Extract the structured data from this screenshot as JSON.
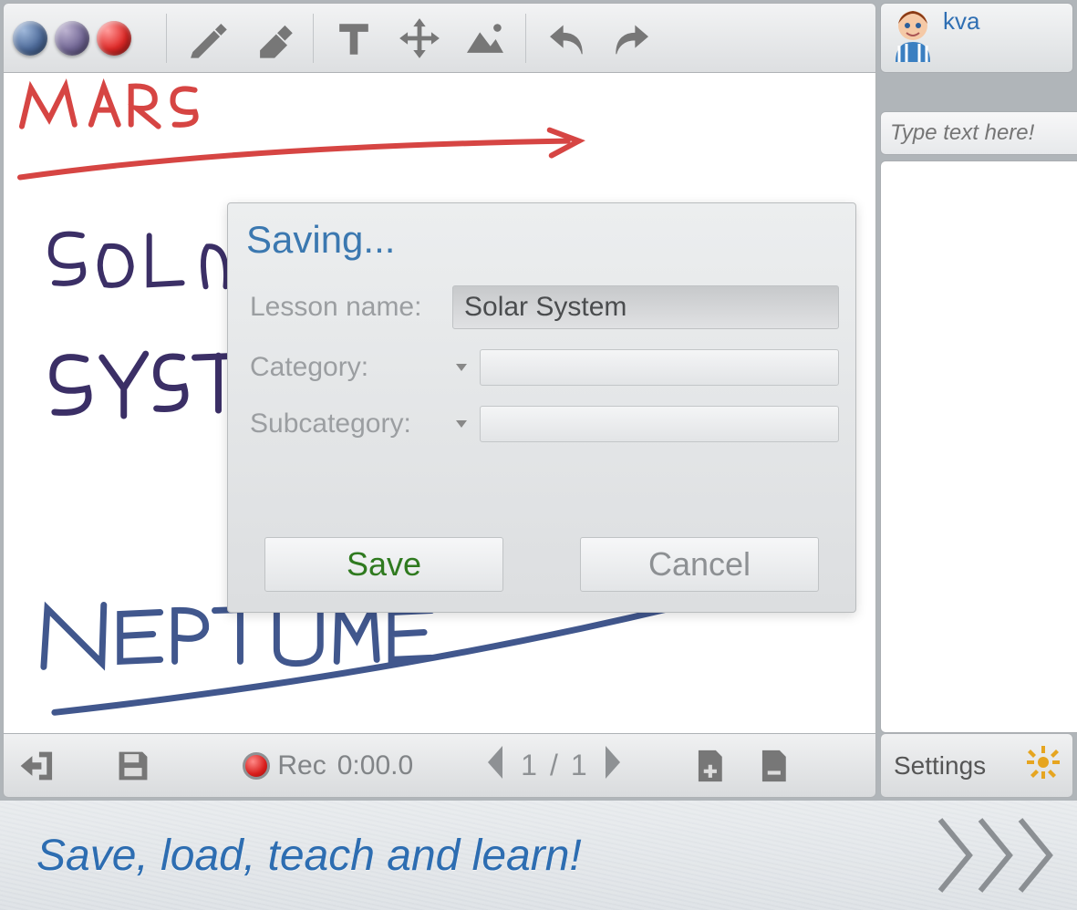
{
  "user": {
    "name": "kva"
  },
  "chat": {
    "placeholder": "Type text here!"
  },
  "toolbar": {
    "colors": [
      "blue",
      "purple",
      "red"
    ]
  },
  "canvas": {
    "words": [
      "MARS",
      "SoLaR",
      "SYSTE",
      "NePTune"
    ]
  },
  "dialog": {
    "title": "Saving...",
    "lesson_label": "Lesson name:",
    "lesson_value": "Solar System",
    "category_label": "Category:",
    "category_value": "",
    "subcategory_label": "Subcategory:",
    "subcategory_value": "",
    "save_label": "Save",
    "cancel_label": "Cancel"
  },
  "bottom": {
    "rec_label": "Rec",
    "rec_time": "0:00.0",
    "page_current": "1",
    "page_sep": "/",
    "page_total": "1"
  },
  "settings": {
    "label": "Settings"
  },
  "footer": {
    "tagline": "Save, load, teach and learn!"
  }
}
